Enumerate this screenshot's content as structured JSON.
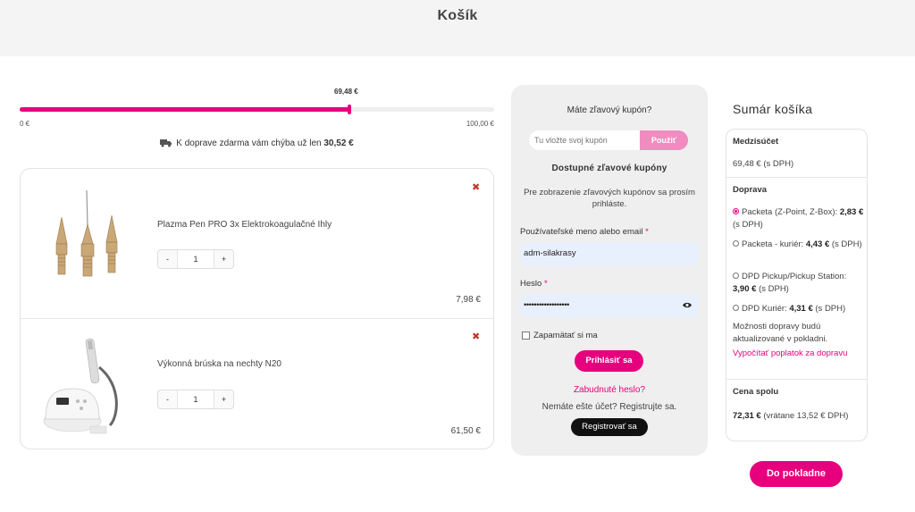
{
  "page": {
    "title": "Košík"
  },
  "progress": {
    "current_label": "69,48 €",
    "min_label": "0 €",
    "max_label": "100,00 €",
    "fill_fraction": 0.6948,
    "note_prefix": "K doprave zdarma vám chýba už len",
    "note_amount": "30,52 €"
  },
  "cart": {
    "items": [
      {
        "name": "Plazma Pen PRO 3x Elektrokoagulačné Ihly",
        "qty": "1",
        "price": "7,98 €",
        "minus": "-",
        "plus": "+",
        "remove": "✖",
        "image": "needles-icon"
      },
      {
        "name": "Výkonná brúska na nechty N20",
        "qty": "1",
        "price": "61,50 €",
        "minus": "-",
        "plus": "+",
        "remove": "✖",
        "image": "nail-drill-icon"
      }
    ]
  },
  "coupon": {
    "question": "Máte zľavový kupón?",
    "placeholder": "Tu vložte svoj kupón",
    "apply_label": "Použiť",
    "available_title": "Dostupné zľavové kupóny",
    "info": "Pre zobrazenie zľavových kupónov sa prosím prihláste."
  },
  "login": {
    "username_label": "Používateľské meno alebo email",
    "username_value": "adm-silakrasy",
    "password_label": "Heslo",
    "password_value": "••••••••••••••••••",
    "required_mark": "*",
    "remember_label": "Zapamätať si ma",
    "login_button": "Prihlásiť sa",
    "forgot_link": "Zabudnuté heslo?",
    "no_account": "Nemáte ešte účet? Registrujte sa.",
    "register_button": "Registrovať sa"
  },
  "summary": {
    "title": "Sumár košíka",
    "subtotal_label": "Medzisúčet",
    "subtotal_value": "69,48 €",
    "subtotal_suffix": "(s DPH)",
    "shipping_label": "Doprava",
    "shipping_options": [
      {
        "name": "Packeta (Z-Point, Z-Box):",
        "price": "2,83 €",
        "suffix": "(s DPH)",
        "selected": true
      },
      {
        "name": "Packeta - kuriér:",
        "price": "4,43 €",
        "suffix": "(s DPH)",
        "selected": false
      },
      {
        "name": "DPD Pickup/Pickup Station:",
        "price": "3,90 €",
        "suffix": "(s DPH)",
        "selected": false
      },
      {
        "name": "DPD Kuriér:",
        "price": "4,31 €",
        "suffix": "(s DPH)",
        "selected": false
      }
    ],
    "shipping_note": "Možnosti dopravy budú aktualizované v pokladni.",
    "shipping_calc_link": "Vypočítať poplatok za dopravu",
    "total_label": "Cena spolu",
    "total_value": "72,31 €",
    "total_suffix": "(vrátane 13,52 € DPH)",
    "checkout_button": "Do pokladne"
  },
  "colors": {
    "accent": "#e6007e",
    "accent_light": "#f08cc0",
    "panel_bg": "#efefef",
    "header_bg": "#f4f4f4"
  }
}
